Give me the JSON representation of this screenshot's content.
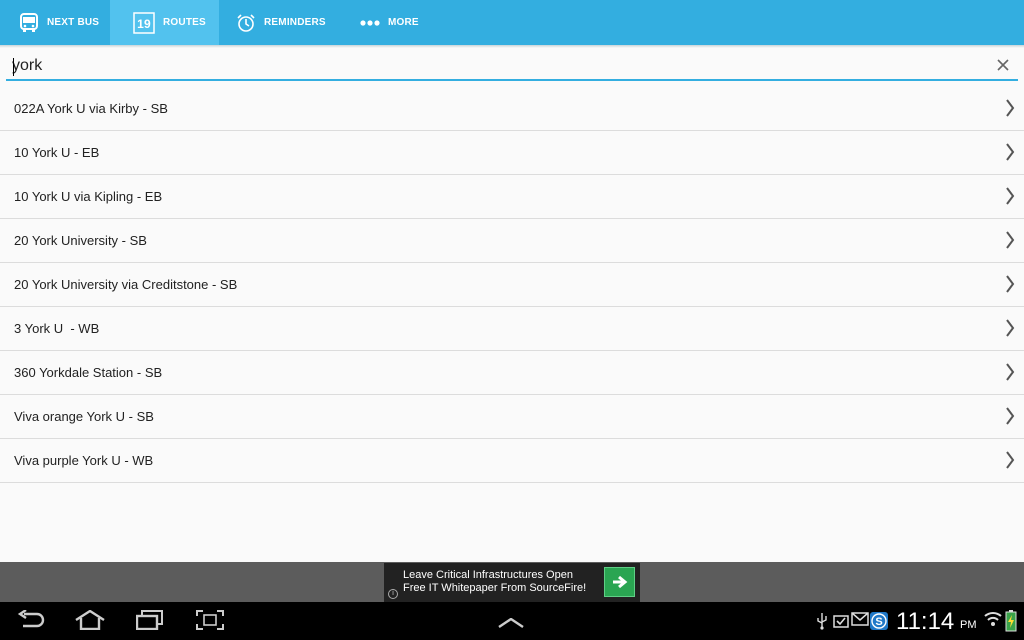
{
  "tabs": [
    {
      "label": "NEXT BUS",
      "icon": "bus-icon"
    },
    {
      "label": "ROUTES",
      "icon": "calendar-icon",
      "badge": "19"
    },
    {
      "label": "REMINDERS",
      "icon": "alarm-clock-icon"
    },
    {
      "label": "MORE",
      "icon": "more-dots-icon"
    }
  ],
  "search": {
    "value": "york",
    "placeholder": ""
  },
  "routes": [
    "022A York U via Kirby - SB",
    "10 York U - EB",
    "10 York U via Kipling - EB",
    "20 York University - SB",
    "20 York University via Creditstone - SB",
    "3 York U  - WB",
    "360 Yorkdale Station - SB",
    "Viva orange York U - SB",
    "Viva purple York U - WB"
  ],
  "ad": {
    "line1": "Leave Critical Infrastructures Open",
    "line2": "Free IT Whitepaper From SourceFire!",
    "info_glyph": "i"
  },
  "statusbar": {
    "time": "11:14",
    "ampm": "PM"
  },
  "colors": {
    "accent": "#33aee0",
    "active_tab": "#52c2ee",
    "ad_button": "#2aa552"
  }
}
